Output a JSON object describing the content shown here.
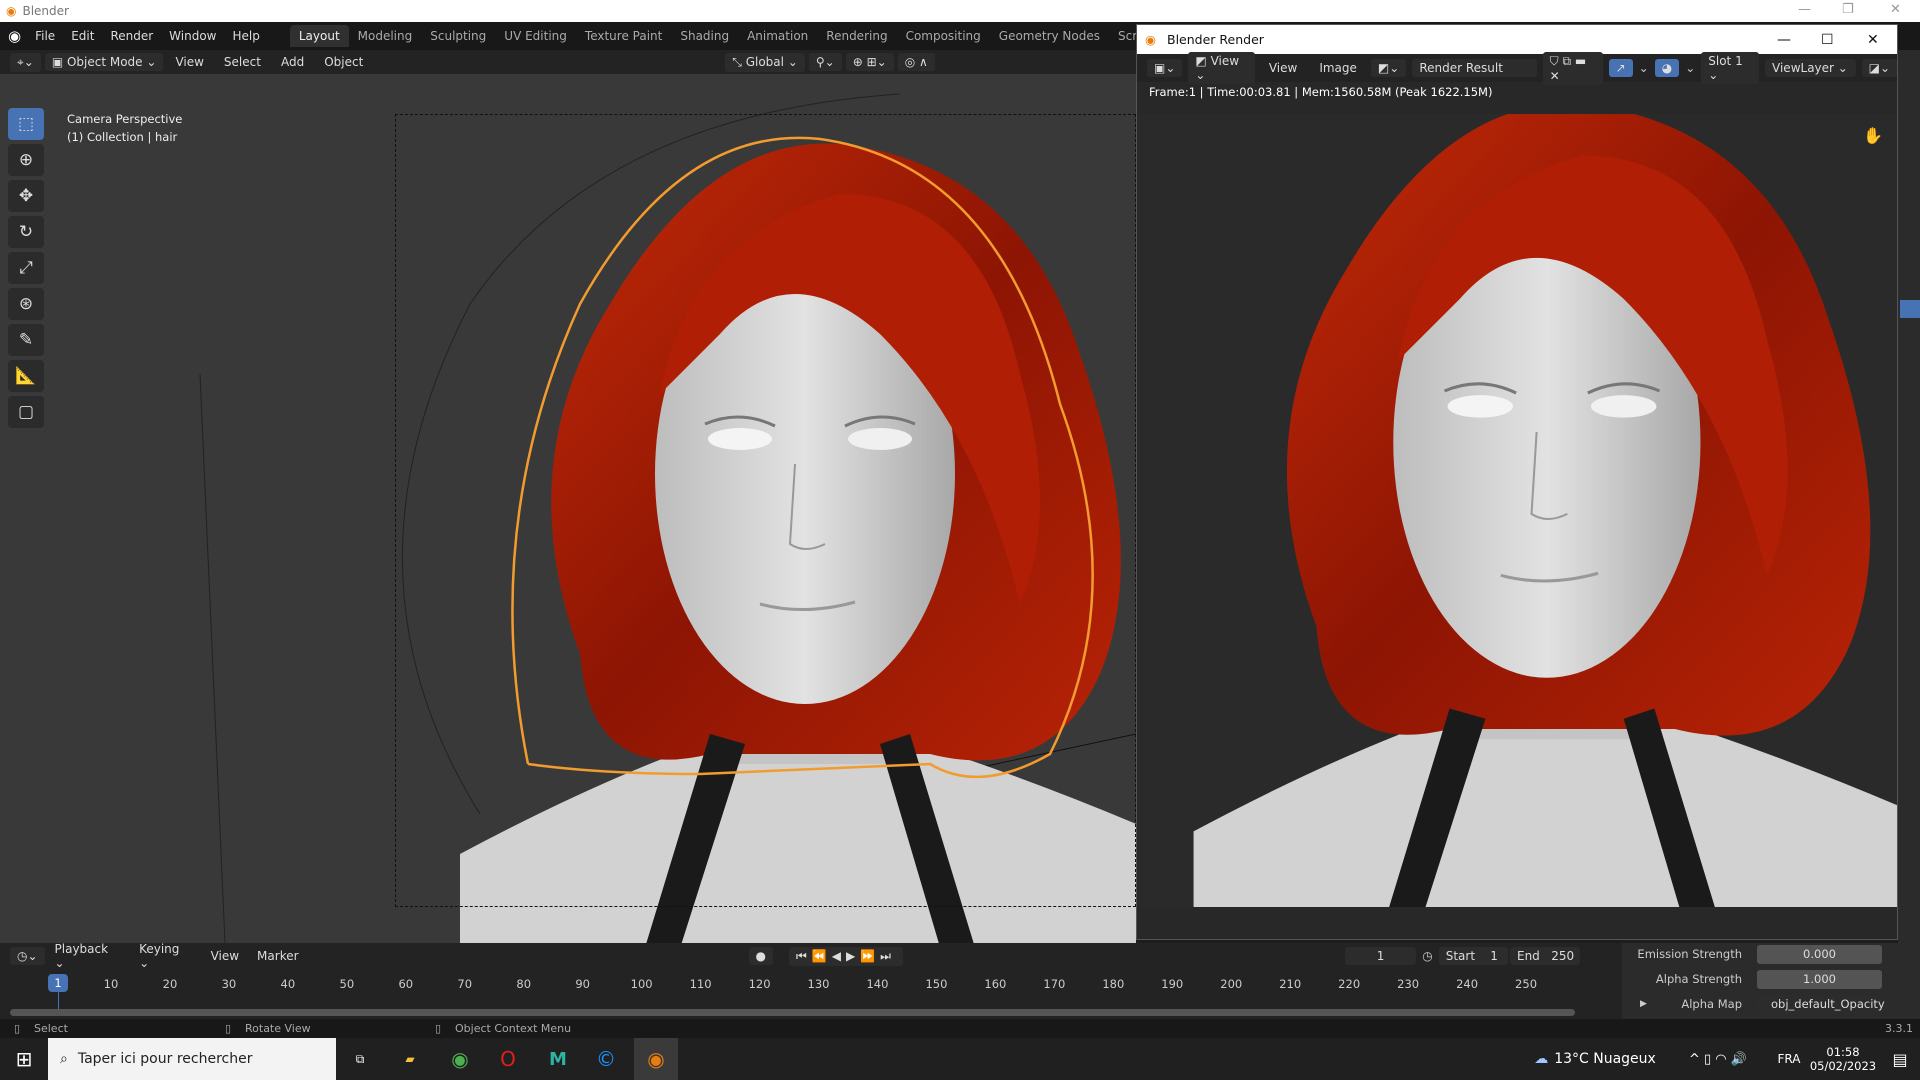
{
  "window": {
    "title": "Blender",
    "minimize": "—",
    "maximize": "❐",
    "close": "✕"
  },
  "menu": [
    "File",
    "Edit",
    "Render",
    "Window",
    "Help"
  ],
  "workspaces": [
    "Layout",
    "Modeling",
    "Sculpting",
    "UV Editing",
    "Texture Paint",
    "Shading",
    "Animation",
    "Rendering",
    "Compositing",
    "Geometry Nodes",
    "Scripting",
    "+"
  ],
  "viewport_header": {
    "mode": "Object Mode",
    "items": [
      "View",
      "Select",
      "Add",
      "Object"
    ],
    "orientation": "Global"
  },
  "viewport": {
    "camera": "Camera Perspective",
    "collection": "(1) Collection | hair"
  },
  "render_window": {
    "title": "Blender Render",
    "header": {
      "view1": "View",
      "view2": "View",
      "image": "Image",
      "image_name": "Render Result",
      "slot": "Slot 1",
      "layer": "ViewLayer"
    },
    "info": "Frame:1 | Time:00:03.81 | Mem:1560.58M (Peak 1622.15M)"
  },
  "timeline": {
    "menus": [
      "Playback",
      "Keying",
      "View",
      "Marker"
    ],
    "current_frame": "1",
    "start_label": "Start",
    "start": "1",
    "end_label": "End",
    "end": "250",
    "frame_ticks": [
      "10",
      "20",
      "30",
      "40",
      "50",
      "60",
      "70",
      "80",
      "90",
      "100",
      "110",
      "120",
      "130",
      "140",
      "150",
      "160",
      "170",
      "180",
      "190",
      "200",
      "210",
      "220",
      "230",
      "240",
      "250"
    ]
  },
  "properties": [
    {
      "label": "Emission Strength",
      "value": "0.000"
    },
    {
      "label": "Alpha Strength",
      "value": "1.000"
    },
    {
      "label": "Alpha Map",
      "value": "obj_default_Opacity"
    }
  ],
  "status": {
    "select": "Select",
    "rotate": "Rotate View",
    "context": "Object Context Menu",
    "version": "3.3.1"
  },
  "taskbar": {
    "search": "Taper ici pour rechercher",
    "weather": "13°C  Nuageux",
    "lang": "FRA",
    "time": "01:58",
    "date": "05/02/2023"
  },
  "colors": {
    "accent": "#4772b3",
    "hair": "#a51a05",
    "selection": "#f29b2f"
  }
}
